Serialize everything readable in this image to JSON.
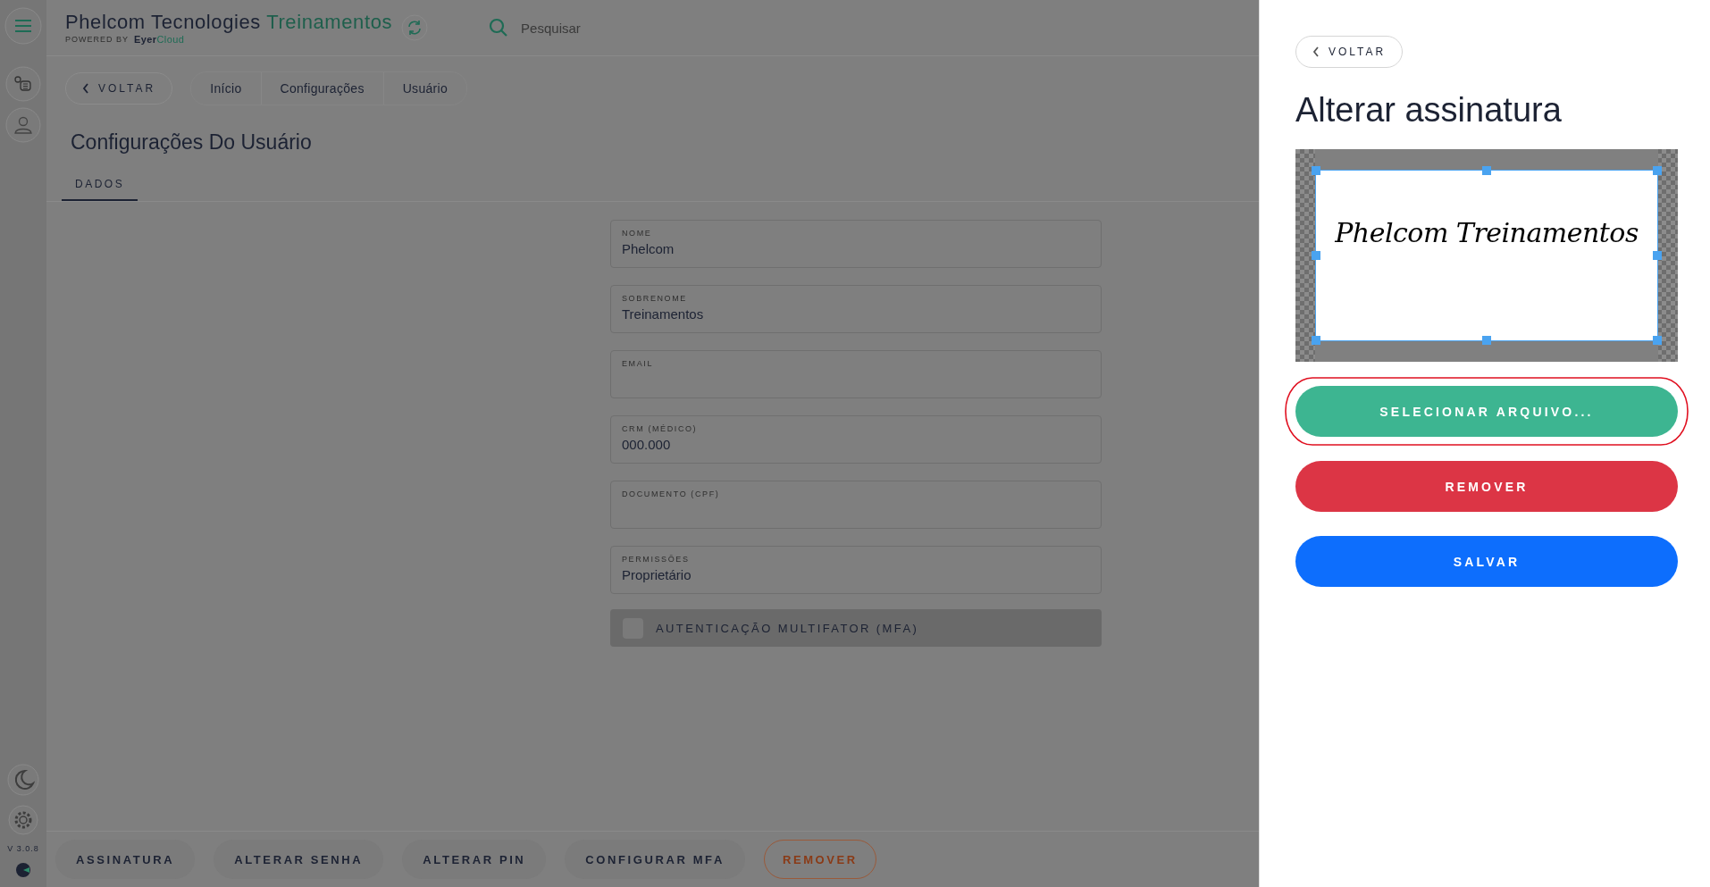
{
  "sidebar": {
    "version": "V 3.0.8"
  },
  "header": {
    "title": "Phelcom Tecnologies",
    "title_accent": "Treinamentos",
    "powered_by": "POWERED BY",
    "brand": "Eyer",
    "brand_accent": "Cloud",
    "search": {
      "placeholder": "Pesquisar"
    }
  },
  "back_button": "VOLTAR",
  "breadcrumbs": [
    "Início",
    "Configurações",
    "Usuário"
  ],
  "page_title": "Configurações Do Usuário",
  "tabs": [
    {
      "label": "DADOS",
      "selected": true
    }
  ],
  "fields": [
    {
      "label": "NOME",
      "value": "Phelcom"
    },
    {
      "label": "SOBRENOME",
      "value": "Treinamentos"
    },
    {
      "label": "EMAIL"
    },
    {
      "label": "CRM (MÉDICO)",
      "value": "000.000"
    },
    {
      "label": "DOCUMENTO (CPF)"
    },
    {
      "label": "PERMISSÕES",
      "value": "Proprietário"
    }
  ],
  "mfa": {
    "label": "AUTENTICAÇÃO MULTIFATOR (MFA)",
    "checked": false
  },
  "actions": [
    {
      "label": "ASSINATURA",
      "kind": "plain"
    },
    {
      "label": "ALTERAR SENHA",
      "kind": "plain"
    },
    {
      "label": "ALTERAR PIN",
      "kind": "plain"
    },
    {
      "label": "CONFIGURAR MFA",
      "kind": "plain"
    },
    {
      "label": "REMOVER",
      "kind": "danger"
    }
  ],
  "panel": {
    "back_button": "VOLTAR",
    "title": "Alterar assinatura",
    "signature_text": "Phelcom Treinamentos",
    "buttons": [
      {
        "label": "SELECIONAR ARQUIVO...",
        "kind": "select",
        "highlighted": true
      },
      {
        "label": "REMOVER",
        "kind": "remove",
        "highlighted": false
      },
      {
        "label": "SALVAR",
        "kind": "save",
        "highlighted": false
      }
    ]
  }
}
